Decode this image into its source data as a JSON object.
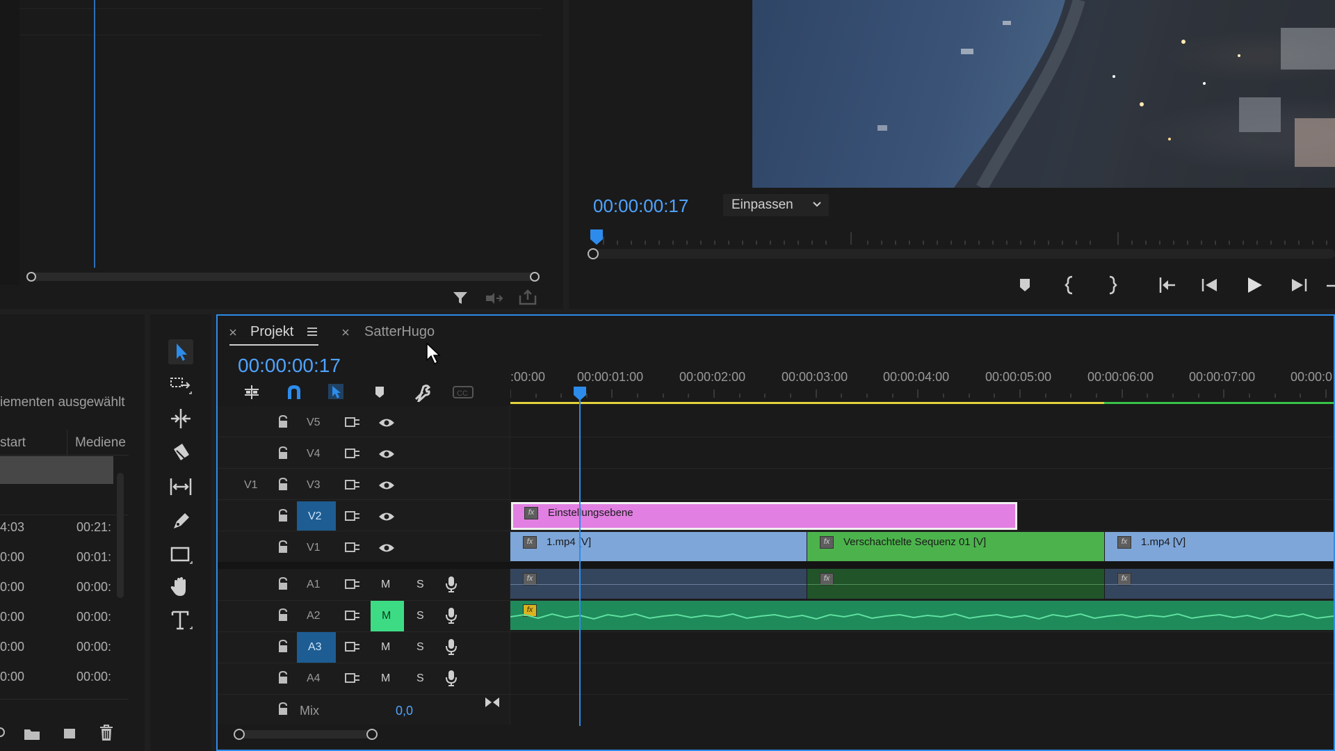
{
  "program": {
    "timecode": "00:00:00:17",
    "fit_dropdown": "Einpassen"
  },
  "project": {
    "selection_text": "iementen ausgewählt",
    "columns": [
      "start",
      "Mediene"
    ],
    "rows": [
      {
        "start": "4:03",
        "media": "00:21:"
      },
      {
        "start": "0:00",
        "media": "00:01:"
      },
      {
        "start": "0:00",
        "media": "00:00:"
      },
      {
        "start": "0:00",
        "media": "00:00:"
      },
      {
        "start": "0:00",
        "media": "00:00:"
      },
      {
        "start": "0:00",
        "media": "00:00:"
      }
    ]
  },
  "timeline": {
    "tabs": [
      {
        "label": "Projekt",
        "active": true
      },
      {
        "label": "SatterHugo",
        "active": false
      }
    ],
    "timecode": "00:00:00:17",
    "ruler_labels": [
      ":00:00",
      "00:00:01:00",
      "00:00:02:00",
      "00:00:03:00",
      "00:00:04:00",
      "00:00:05:00",
      "00:00:06:00",
      "00:00:07:00",
      "00:00:0"
    ],
    "video_tracks": [
      {
        "name": "V5",
        "source": "",
        "targeted": false
      },
      {
        "name": "V4",
        "source": "",
        "targeted": false
      },
      {
        "name": "V3",
        "source": "V1",
        "targeted": false
      },
      {
        "name": "V2",
        "source": "",
        "targeted": true
      },
      {
        "name": "V1",
        "source": "",
        "targeted": false
      }
    ],
    "audio_tracks": [
      {
        "name": "A1",
        "targeted": false,
        "muted": false
      },
      {
        "name": "A2",
        "targeted": false,
        "muted": true
      },
      {
        "name": "A3",
        "targeted": true,
        "muted": false
      },
      {
        "name": "A4",
        "targeted": false,
        "muted": false
      }
    ],
    "mute_label": "M",
    "solo_label": "S",
    "mix_label": "Mix",
    "mix_value": "0,0",
    "clips": {
      "adjustment_layer": "Einstellungsebene",
      "v1_clip_a": "1.mp4 [V]",
      "v1_clip_b": "Verschachtelte Sequenz 01 [V]",
      "v1_clip_c": "1.mp4 [V]"
    },
    "fx_label": "fx"
  },
  "colors": {
    "accent_blue": "#2d8ceb",
    "timecode_blue": "#4fa3ff",
    "adjustment_pink": "#e27fe2",
    "clip_blue": "#7ea6d9",
    "clip_green": "#4cb34c",
    "audio_green": "#1f8a5a",
    "mute_active": "#3ddc84"
  }
}
